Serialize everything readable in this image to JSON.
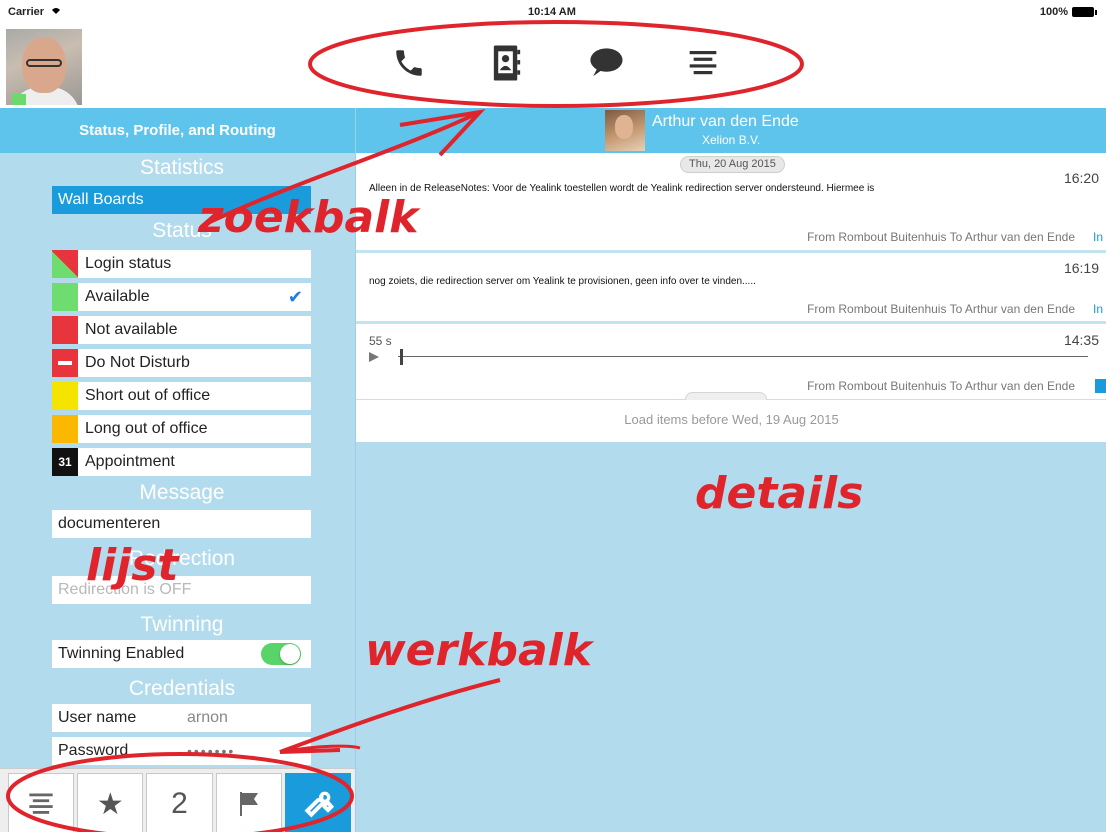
{
  "status_bar": {
    "carrier": "Carrier",
    "time": "10:14 AM",
    "battery": "100%"
  },
  "top_nav": {
    "icons": [
      "phone-icon",
      "contacts-icon",
      "chat-icon",
      "list-icon"
    ]
  },
  "left_panel": {
    "header": "Status, Profile, and Routing",
    "statistics_title": "Statistics",
    "wall_boards": "Wall Boards",
    "status_title": "Status",
    "statuses": [
      {
        "label": "Login status",
        "color": "#e8343c"
      },
      {
        "label": "Available",
        "color": "#6fdc6f",
        "selected": true
      },
      {
        "label": "Not available",
        "color": "#e8343c"
      },
      {
        "label": "Do Not Disturb",
        "color": "#e8343c"
      },
      {
        "label": "Short out of office",
        "color": "#f5e400"
      },
      {
        "label": "Long out of office",
        "color": "#fbb800"
      },
      {
        "label": "Appointment",
        "color": "#111111",
        "badge": "31"
      }
    ],
    "message_title": "Message",
    "message_value": "documenteren",
    "redirection_title": "Redirection",
    "redirection_value": "Redirection is OFF",
    "twinning_title": "Twinning",
    "twinning_label": "Twinning Enabled",
    "twinning_on": true,
    "credentials_title": "Credentials",
    "username_label": "User name",
    "username_value": "arnon",
    "password_label": "Password",
    "password_value": "•••••••"
  },
  "toolbar": {
    "buttons": [
      {
        "icon": "list-icon"
      },
      {
        "icon": "star-icon",
        "glyph": "★"
      },
      {
        "icon": "number-2-icon",
        "glyph": "2"
      },
      {
        "icon": "flag-icon"
      },
      {
        "icon": "wrench-icon",
        "active": true
      }
    ]
  },
  "right_panel": {
    "contact_name": "Arthur van den Ende",
    "contact_company": "Xelion B.V.",
    "date_label": "Thu, 20 Aug 2015",
    "messages": [
      {
        "text": "Alleen in de ReleaseNotes:  Voor de Yealink toestellen wordt de Yealink redirection server ondersteund. Hiermee is",
        "time": "16:20",
        "from": "From Rombout Buitenhuis To Arthur van den Ende",
        "extra": "In"
      },
      {
        "text": "nog zoiets, die redirection server om Yealink te provisionen, geen info over te vinden.....",
        "time": "16:19",
        "from": "From Rombout Buitenhuis To Arthur van den Ende",
        "extra": "In"
      },
      {
        "duration": "55 s",
        "time": "14:35",
        "from": "From Rombout Buitenhuis To Arthur van den Ende"
      }
    ],
    "more_label": "...",
    "load_more": "Load items before Wed, 19 Aug 2015"
  },
  "annotations": {
    "zoekbalk": "zoekbalk",
    "details": "details",
    "lijst": "lijst",
    "werkbalk": "werkbalk",
    "color": "#e0242c"
  }
}
